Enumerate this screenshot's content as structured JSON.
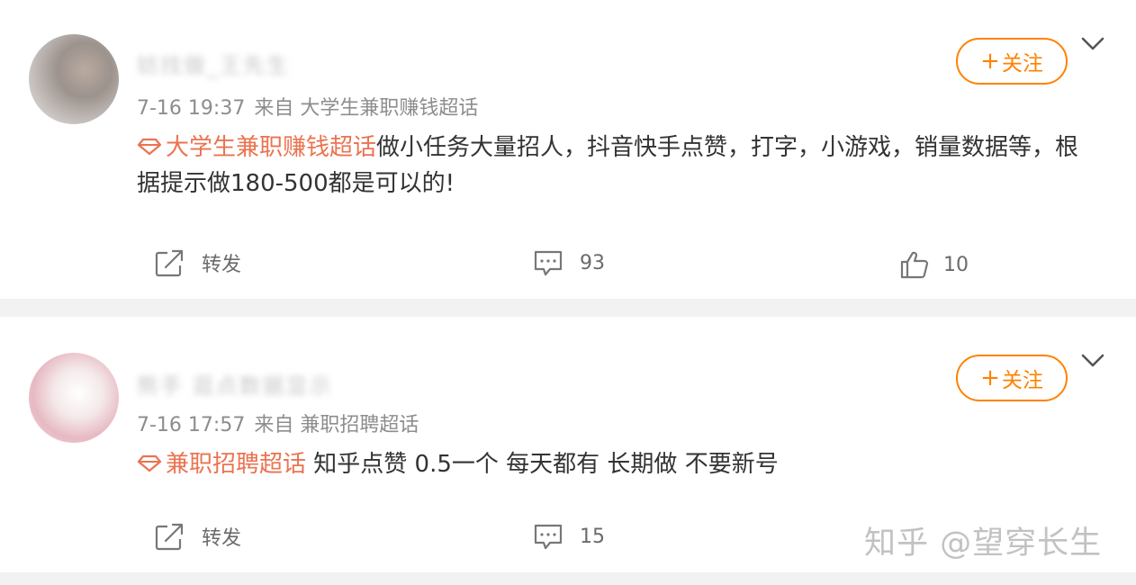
{
  "posts": [
    {
      "username": "妨找做_王先生",
      "time": "7-16 19:37",
      "source": "来自 大学生兼职赚钱超话",
      "follow_label": "关注",
      "topic": "大学生兼职赚钱超话",
      "text": "做小任务大量招人，抖音快手点赞，打字，小游戏，销量数据等，根据提示做180-500都是可以的!",
      "repost_label": "转发",
      "comment_count": "93",
      "like_count": "10"
    },
    {
      "username": "熊手 逛点数据显示",
      "time": "7-16 17:57",
      "source": "来自 兼职招聘超话",
      "follow_label": "关注",
      "topic": "兼职招聘超话",
      "text": " 知乎点赞 0.5一个 每天都有 长期做 不要新号",
      "repost_label": "转发",
      "comment_count": "15"
    }
  ],
  "watermark": "知乎 @望穿长生",
  "colors": {
    "accent": "#ff8200",
    "topic": "#eb7350",
    "separator": "#f2f2f2"
  },
  "icons": [
    "diamond-icon",
    "share-icon",
    "comment-icon",
    "like-icon",
    "chevron-down-icon",
    "plus-icon"
  ]
}
